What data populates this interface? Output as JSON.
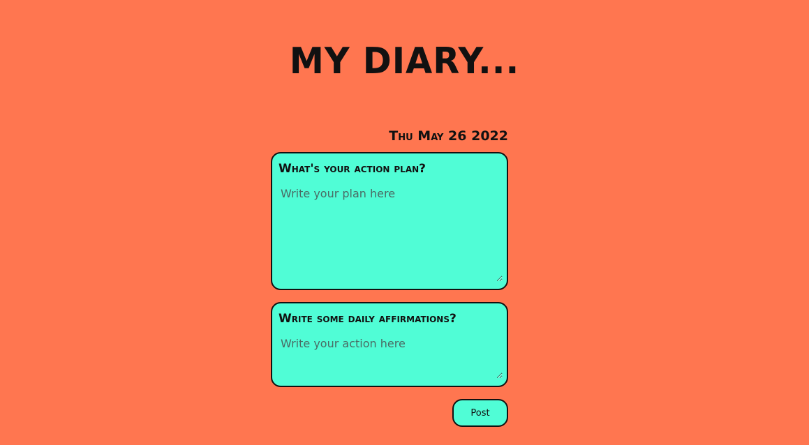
{
  "header": {
    "title": "MY DIARY..."
  },
  "entry": {
    "date": "Thu May 26 2022",
    "plan": {
      "label": "What's your action plan?",
      "placeholder": "Write your plan here"
    },
    "affirmations": {
      "label": "Write some daily affirmations?",
      "placeholder": "Write your action here"
    },
    "post_label": "Post"
  },
  "colors": {
    "background": "#ff7650",
    "card": "#50fdd6",
    "border": "#111111"
  }
}
